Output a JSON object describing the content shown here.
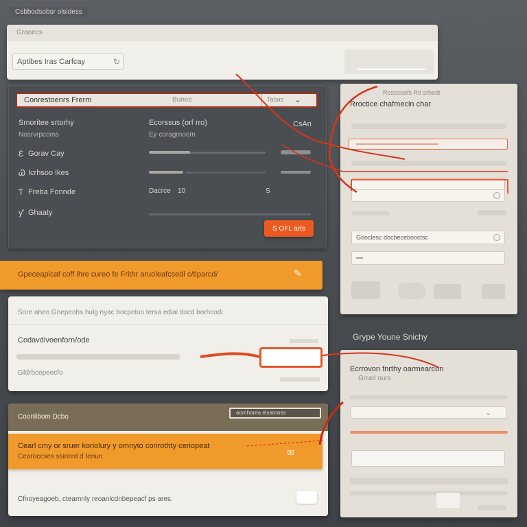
{
  "window": {
    "title": "Csbbodsobsr olsidess"
  },
  "top_panel": {
    "tab_label": "Graoecs",
    "input_value": "Aptibes Iras Carfcay"
  },
  "dark_form": {
    "title_bar_label": "Conrestoenrs Frerm",
    "title_bar_mid": "Bunes",
    "title_bar_right": "Tabas",
    "heading_left": "Smoritee srtorhy",
    "heading_right": "Ecorssus (orf rro)",
    "sub_left": "Nosrvrpcoms",
    "sub_right": "Ey coragrnoom",
    "right_tag": "CsAn",
    "options": [
      {
        "icon": "Ɛ",
        "label": "Gorav Cay"
      },
      {
        "icon": "Ꮚ",
        "label": "Icrhsoo Ikes"
      },
      {
        "icon": "Ƭ",
        "label": "Freba Fonnde"
      },
      {
        "icon": "ƴ",
        "label": "Ghaaty"
      }
    ],
    "field_label": "Dacrce",
    "field_value": "10",
    "field_trailing": "S",
    "submit_label": "S OFL arts"
  },
  "banner_top": {
    "text": "Gpeceapicaf coff ihre cureo fe Frithr aruoleafcsedl c/tiparcd/"
  },
  "mid_panel": {
    "description": "Sore aheo Gnepeohs hulg nyac bocpeluo tersa ediai docd borhcodi",
    "field_label": "Codavdivoenforn/ode",
    "secondary_label": "Gfdrbcepeecfo"
  },
  "right_panel_top": {
    "badge": "Rcocsoafs Rd srhedt",
    "title": "Rroctice chafmecin char",
    "search_value": "Gooclesc docbecebooctsc"
  },
  "section_label": "Grype Youne Snichy",
  "right_panel_bottom": {
    "title": "Ecrrovon fnrthy oarmearcon",
    "subtitle": "Grrad ours"
  },
  "bottom_panel": {
    "header_label": "Coonlibom Dcbo",
    "header_chip": "aomhorea elsarnoss",
    "banner_title": "Cearl cmy or sruer koriolury y omnyto conrothty ceriopeat",
    "banner_sub": "Cearoccses ssinted d tenun",
    "footer_text": "Cfnoyeagoeb, cteamnly reoanlcdnbepeacf ps ares."
  },
  "colors": {
    "accent_orange": "#f19a2c",
    "button_red": "#ec5a22",
    "annotation_red": "#d8341c"
  }
}
